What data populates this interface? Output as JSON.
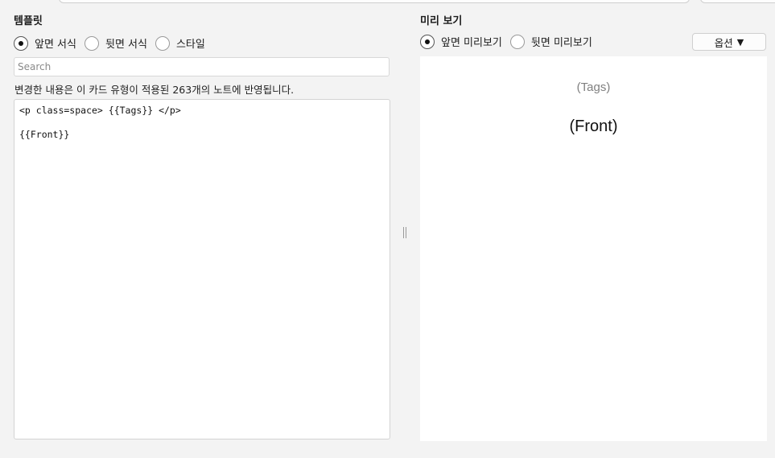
{
  "template": {
    "title": "템플릿",
    "radios": [
      {
        "label": "앞면 서식",
        "checked": true
      },
      {
        "label": "뒷면 서식",
        "checked": false
      },
      {
        "label": "스타일",
        "checked": false
      }
    ],
    "search_placeholder": "Search",
    "info": "변경한 내용은 이 카드 유형이 적용된 263개의 노트에 반영됩니다.",
    "editor_lines": [
      "<p class=space> {{Tags}} </p>",
      "",
      "{{Front}}"
    ]
  },
  "preview": {
    "title": "미리 보기",
    "radios": [
      {
        "label": "앞면 미리보기",
        "checked": true
      },
      {
        "label": "뒷면 미리보기",
        "checked": false
      }
    ],
    "options_label": "옵션",
    "options_caret": "▼",
    "tags_text": "(Tags)",
    "front_text": "(Front)"
  }
}
